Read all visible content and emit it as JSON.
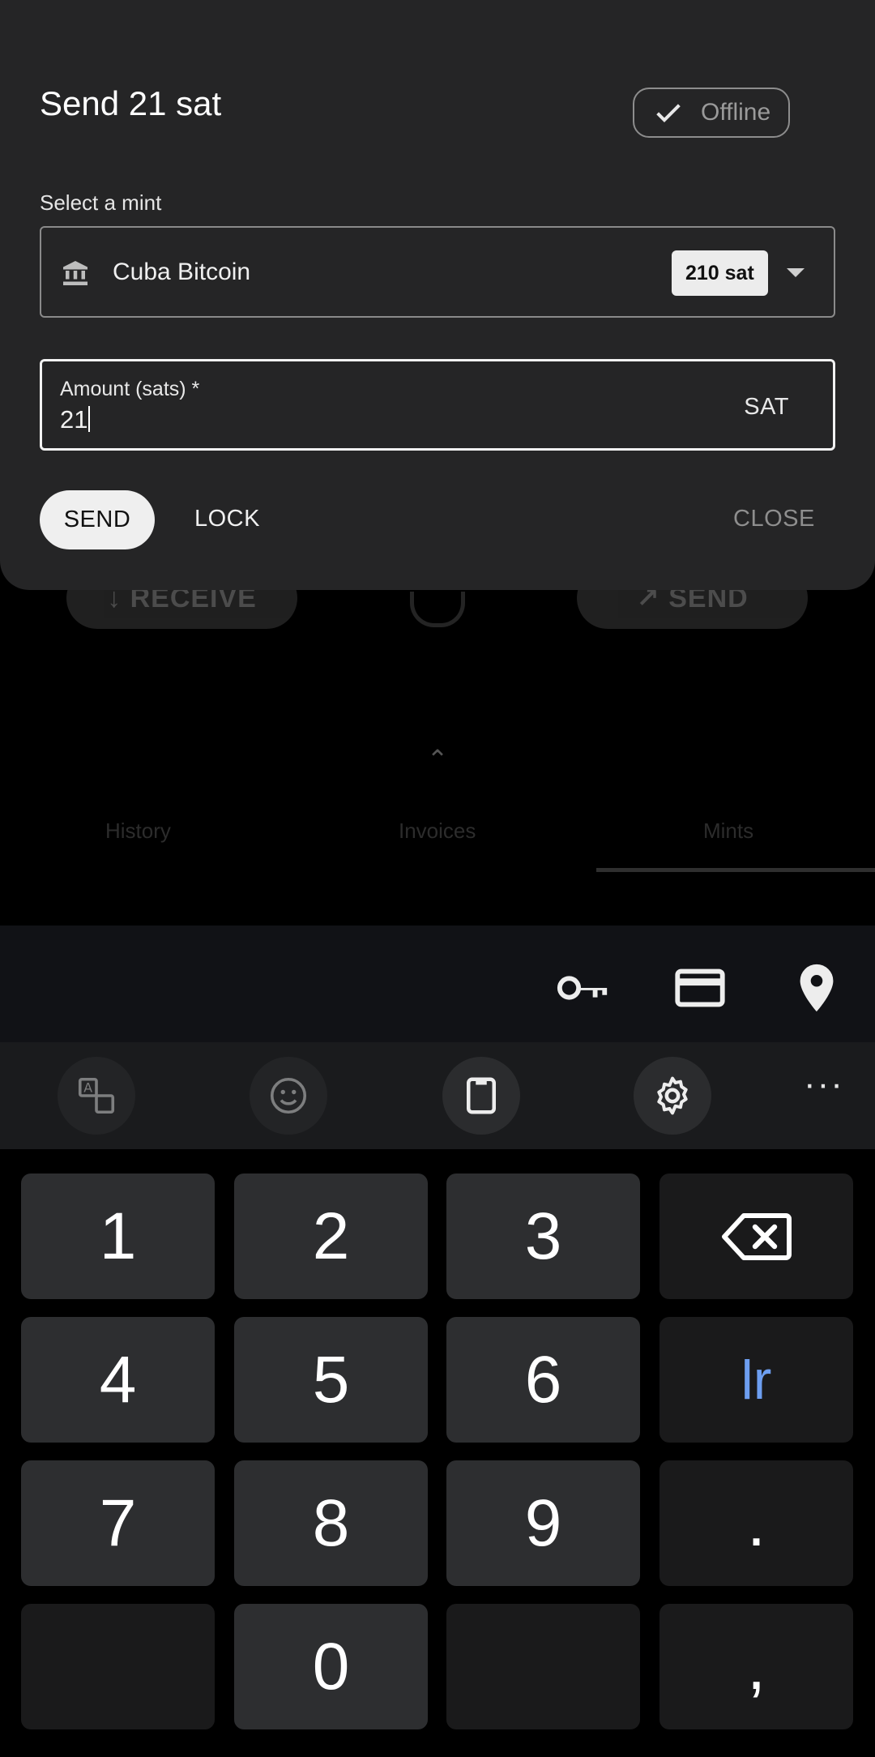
{
  "background": {
    "receive_label": "↓ RECEIVE",
    "send_label": "↗ SEND",
    "tabs": [
      "History",
      "Invoices",
      "Mints"
    ]
  },
  "dialog": {
    "title": "Send 21 sat",
    "offline_chip": {
      "label": "Offline",
      "checked": true
    },
    "mint_label": "Select a mint",
    "mint": {
      "name": "Cuba Bitcoin",
      "balance": "210 sat"
    },
    "amount": {
      "label": "Amount (sats) *",
      "value": "21",
      "unit": "SAT"
    },
    "actions": {
      "send": "SEND",
      "lock": "LOCK",
      "close": "CLOSE"
    }
  },
  "keyboard": {
    "suggestion_icons": [
      "key-icon",
      "credit-card-icon",
      "location-pin-icon"
    ],
    "tool_icons": [
      "translate-icon",
      "emoji-icon",
      "clipboard-icon",
      "settings-gear-icon",
      "more-options-icon"
    ],
    "keys": [
      [
        "1",
        "2",
        "3",
        "backspace"
      ],
      [
        "4",
        "5",
        "6",
        "lr"
      ],
      [
        "7",
        "8",
        "9",
        "."
      ],
      [
        "",
        "0",
        "",
        ","
      ]
    ],
    "lr_label": "lr",
    "accent_color": "#6d9ef0"
  }
}
